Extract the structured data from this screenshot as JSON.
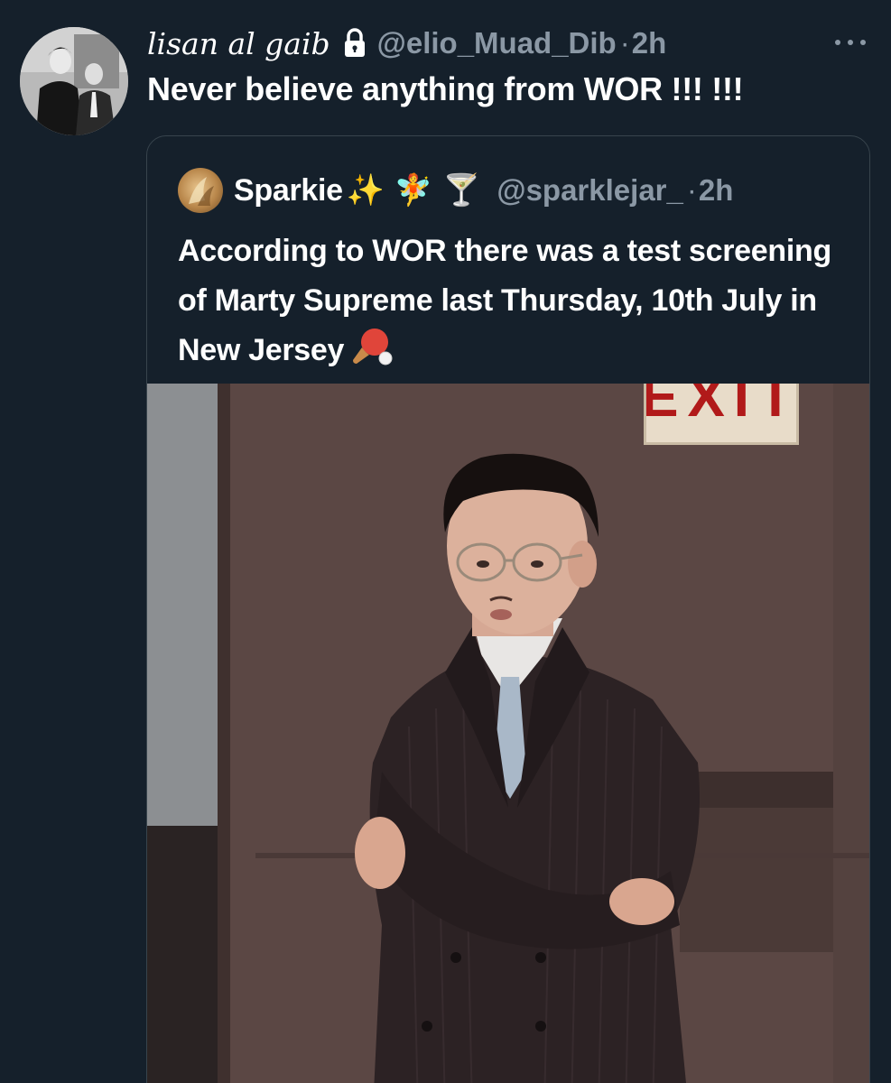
{
  "tweet": {
    "display_name": "lisan al gaib",
    "handle": "@elio_Muad_Dib",
    "separator": "·",
    "time": "2h",
    "text": "Never believe anything from WOR !!! !!!",
    "protected": true
  },
  "quote": {
    "display_name": "Sparkie",
    "name_emojis": "✨ 🧚 🍸",
    "handle": "@sparklejar_",
    "separator": "·",
    "time": "2h",
    "text": "According to WOR there was a test screening of Marty Supreme last Thursday, 10th July in New Jersey",
    "trailing_emoji_icon": "ping-pong-paddle-icon"
  },
  "photo": {
    "sign_text": "EXIT"
  },
  "colors": {
    "background": "#15202b",
    "secondary_text": "#8b98a5",
    "border": "#38444d"
  }
}
